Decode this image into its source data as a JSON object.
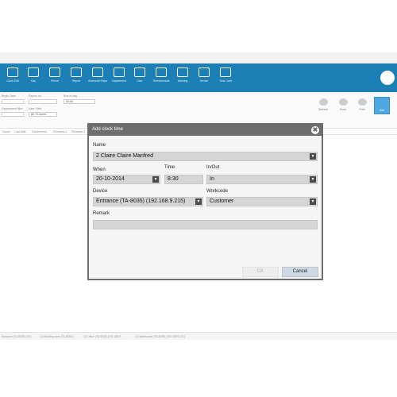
{
  "ribbon": {
    "items": [
      {
        "label": "Clock Edit",
        "icon": "clock-icon"
      },
      {
        "label": "Day",
        "icon": "calendar-icon"
      },
      {
        "label": "Period",
        "icon": "calendar-icon"
      },
      {
        "label": "Report",
        "icon": "report-icon"
      },
      {
        "label": "Workcode Report",
        "icon": "report-icon"
      },
      {
        "label": "Department",
        "icon": "department-icon"
      },
      {
        "label": "User",
        "icon": "user-icon"
      },
      {
        "label": "Timeschedule",
        "icon": "schedule-icon"
      },
      {
        "label": "Warning",
        "icon": "warning-icon"
      },
      {
        "label": "Device",
        "icon": "device-icon"
      },
      {
        "label": "Time Card",
        "icon": "folder-icon"
      }
    ]
  },
  "filters": {
    "begin_date_label": "Begin Date",
    "begin_date_value": "",
    "report_label": "Report on",
    "report_value": "",
    "end_label": "End of day",
    "end_value": "00:00",
    "department_label": "Department filter",
    "department_value": "",
    "user_label": "User Filter",
    "user_value": "All 70 users"
  },
  "tools": [
    "Refresh",
    "Excel",
    "Print",
    "Add"
  ],
  "columns": [
    "Name",
    "Last date",
    "Department",
    "Remarks 1",
    "Remarks 2"
  ],
  "statusbar": [
    "Entrance (TA-8035) (192.",
    "(1) Building zone (TA-8035) (",
    "(1) Office (TA-8035) (192.168.9.",
    "(1) Warehouse (TA-8035) (192.168.9.211)"
  ],
  "dialog": {
    "title": "Add clock time",
    "name_label": "Name",
    "name_value": "2 Claire Claire Manfred",
    "when_label": "When",
    "when_value": "20-10-2014",
    "time_label": "Time",
    "time_value": "8:30",
    "inout_label": "In/Out",
    "inout_value": "In",
    "device_label": "Device",
    "device_value": "Entrance (TA-8035) (192.168.9.215)",
    "workcode_label": "Workcode",
    "workcode_value": "Customer",
    "remark_label": "Remark",
    "remark_value": "",
    "ok_label": "OK",
    "cancel_label": "Cancel",
    "close_glyph": "✖"
  },
  "colors": {
    "ribbon": "#1c7fb6",
    "dialog_frame": "#6d6d6d",
    "cancel_button": "#cfd9e3"
  }
}
